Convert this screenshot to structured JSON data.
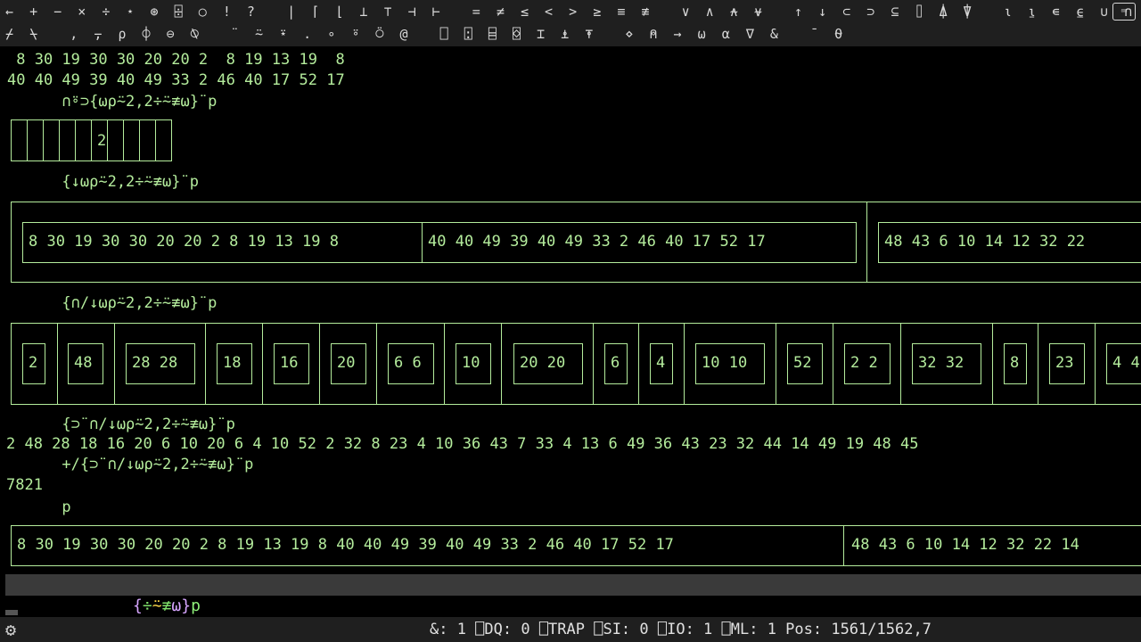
{
  "language_bar": {
    "row1": "←  +  −  ×  ÷  ⋆  ⊛  ⌹  ○  !  ?    |  ⌈  ⌊  ⊥  ⊤  ⊣  ⊢    =  ≠  ≤  <  >  ≥  ≡  ≢    ∨  ∧  ⍲  ⍱    ↑  ↓  ⊂  ⊃  ⊆  ⌷  ⍋  ⍒    ⍳  ⍸  ∊  ⍷  ∪  ∩  ~    /  \\",
    "row2": "⌿  ⍀    ,  ⍪  ⍴  ⌽  ⊖  ⍉    ¨  ⍨  ⍣  .  ∘  ⍤  ⍥  @    ⎕  ⍠  ⌸  ⌺  ⌶  ⍎  ⍕    ⋄  ⍝  →  ⍵  ⍺  ∇  &    ¯  ⍬",
    "keyboard_label": "⌨"
  },
  "session": {
    "line_a": " 8 30 19 30 30 20 20 2  8 19 13 19  8",
    "line_b": "40 40 49 39 40 49 33 2 46 40 17 52 17",
    "expr1": "      ∩⍤⊃{⍵⍴⍨2,2÷⍨≢⍵}¨p",
    "box1_value": "2",
    "expr2": "      {↓⍵⍴⍨2,2÷⍨≢⍵}¨p",
    "box2_row1": "8 30 19 30 30 20 20 2 8 19 13 19 8",
    "box2_row2": "40 40 49 39 40 49 33 2 46 40 17 52 17",
    "box2_next": "48 43 6 10 14 12 32 22",
    "expr3": "      {∩/↓⍵⍴⍨2,2÷⍨≢⍵}¨p",
    "box3_items": [
      "2",
      "48",
      "28 28",
      "18",
      "16",
      "20",
      "6 6",
      "10",
      "20 20",
      "6",
      "4",
      "10 10",
      "52",
      "2 2",
      "32 32",
      "8",
      "23",
      "4 4"
    ],
    "expr4": "      {⊃¨∩/↓⍵⍴⍨2,2÷⍨≢⍵}¨p",
    "result4": "2 48 28 18 16 20 6 10 20 6 4 10 52 2 32 8 23 4 10 36 43 7 33 4 13 6 49 36 43 23 32 44 14 49 19 48 45",
    "expr5": "      +/{⊃¨∩/↓⍵⍴⍨2,2÷⍨≢⍵}¨p",
    "result5": "7821",
    "expr6": "      p",
    "box6_row1": "8 30 19 30 30 20 20 2 8 19 13 19 8 40 40 49 39 40 49 33 2 46 40 17 52 17",
    "box6_next": "48 43 6 10 14 12 32 22 14"
  },
  "input_line": {
    "brace_open": "{",
    "fn1": "÷",
    "op1": "⍨",
    "fn2": "≢",
    "var": "⍵",
    "brace_close": "}",
    "rest": "p"
  },
  "status": {
    "text": "&: 1 ⎕DQ: 0 ⎕TRAP ⎕SI: 0 ⎕IO: 1 ⎕ML: 1 Pos: 1561/1562,7"
  },
  "colors": {
    "background": "#000000",
    "output_text": "#b4ec9c",
    "bar_background": "#1f1f1f",
    "input_background": "#3a3a3a"
  },
  "icons": {
    "settings": "gear-icon",
    "keyboard": "keyboard-icon"
  }
}
